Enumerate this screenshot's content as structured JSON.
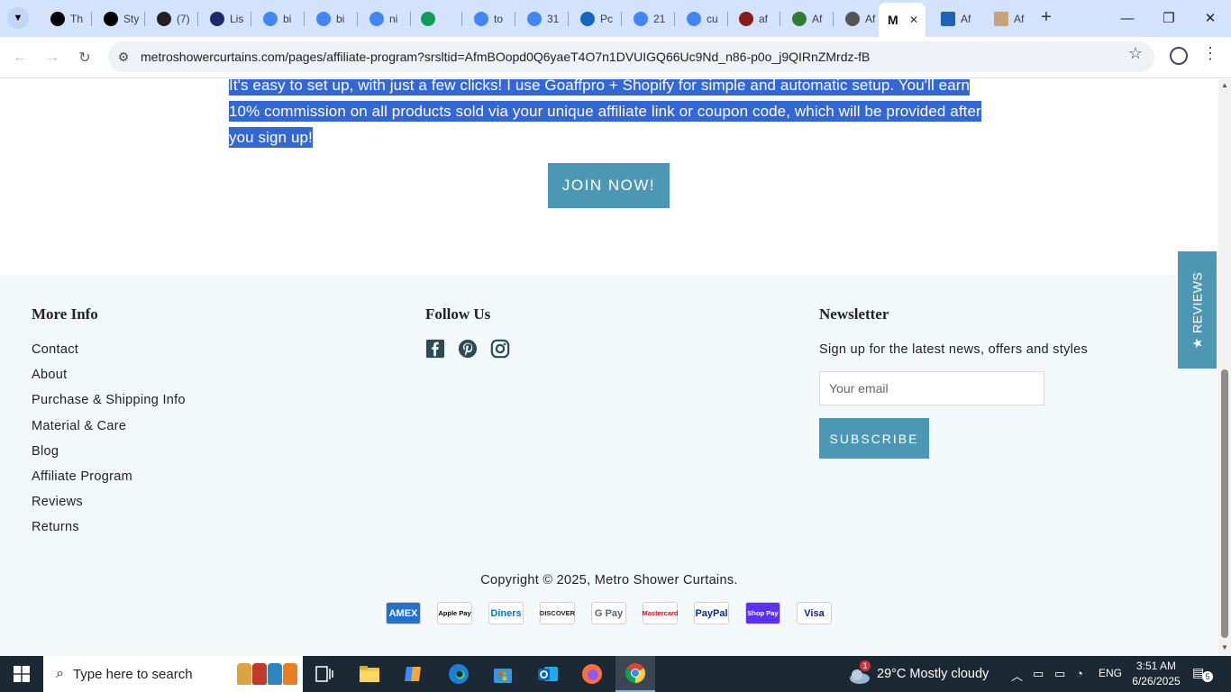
{
  "browser": {
    "tabs": [
      {
        "label": "Th",
        "icon": "threads-icon",
        "color": "#000000"
      },
      {
        "label": "Sty",
        "icon": "threads-icon",
        "color": "#000000"
      },
      {
        "label": "(7)",
        "icon": "quora-icon",
        "color": "#222222"
      },
      {
        "label": "Lis",
        "icon": "ttp-icon",
        "color": "#1a2a6c"
      },
      {
        "label": "bi",
        "icon": "google-icon",
        "color": "#4285f4"
      },
      {
        "label": "bi",
        "icon": "google-icon",
        "color": "#4285f4"
      },
      {
        "label": "ni",
        "icon": "google-icon",
        "color": "#4285f4"
      },
      {
        "label": "",
        "icon": "extension-icon",
        "color": "#0f9d58"
      },
      {
        "label": "to",
        "icon": "google-icon",
        "color": "#4285f4"
      },
      {
        "label": "31",
        "icon": "google-icon",
        "color": "#4285f4"
      },
      {
        "label": "Pc",
        "icon": "xenforo-icon",
        "color": "#1565c0"
      },
      {
        "label": "21",
        "icon": "google-icon",
        "color": "#4285f4"
      },
      {
        "label": "cu",
        "icon": "google-icon",
        "color": "#4285f4"
      },
      {
        "label": "af",
        "icon": "font-icon",
        "color": "#8b1a1a"
      },
      {
        "label": "Af",
        "icon": "sheet-icon",
        "color": "#2e7d32"
      },
      {
        "label": "Af",
        "icon": "curtain-icon",
        "color": "#555555"
      }
    ],
    "active_tab": {
      "label": "M",
      "close": "✕"
    },
    "after_tabs": [
      {
        "label": "Af",
        "icon": "doc-icon",
        "color": "#1e63b5"
      },
      {
        "label": "Af",
        "icon": "curtain-icon",
        "color": "#c8a27a"
      }
    ],
    "new_tab": "+",
    "url": "metroshowercurtains.com/pages/affiliate-program?srsltid=AfmBOopd0Q6yaeT4O7n1DVUIGQ66Uc9Nd_n86-p0o_j9QIRnZMrdz-fB"
  },
  "page": {
    "selected_paragraph": "It's easy to set up, with just a few clicks! I use Goaffpro + Shopify for simple and automatic setup. You'll earn 10% commission on all products sold via your unique affiliate link or coupon code, which will be provided after you sign up!",
    "join_button": "JOIN NOW!",
    "footer": {
      "more_info_title": "More Info",
      "links": [
        "Contact",
        "About",
        "Purchase & Shipping Info",
        "Material & Care",
        "Blog",
        "Affiliate Program",
        "Reviews",
        "Returns"
      ],
      "follow_title": "Follow Us",
      "social": [
        "facebook-icon",
        "pinterest-icon",
        "instagram-icon"
      ],
      "newsletter_title": "Newsletter",
      "newsletter_text": "Sign up for the latest news, offers and styles",
      "email_placeholder": "Your email",
      "subscribe_button": "SUBSCRIBE",
      "copyright": "Copyright © 2025, Metro Shower Curtains.",
      "payments": [
        {
          "name": "AMEX",
          "bg": "#1f72cd",
          "fg": "#ffffff"
        },
        {
          "name": "Apple Pay",
          "bg": "#ffffff",
          "fg": "#000000"
        },
        {
          "name": "Diners",
          "bg": "#ffffff",
          "fg": "#0079be"
        },
        {
          "name": "DISCOVER",
          "bg": "#ffffff",
          "fg": "#222222"
        },
        {
          "name": "G Pay",
          "bg": "#ffffff",
          "fg": "#5f6368"
        },
        {
          "name": "Mastercard",
          "bg": "#ffffff",
          "fg": "#eb001b"
        },
        {
          "name": "PayPal",
          "bg": "#ffffff",
          "fg": "#003087"
        },
        {
          "name": "Shop Pay",
          "bg": "#5a31f4",
          "fg": "#ffffff"
        },
        {
          "name": "Visa",
          "bg": "#ffffff",
          "fg": "#1a1f71"
        }
      ]
    },
    "reviews_tab": "★ REVIEWS"
  },
  "taskbar": {
    "search_placeholder": "Type here to search",
    "weather": "29°C  Mostly cloudy",
    "weather_badge": "1",
    "language": "ENG",
    "time": "3:51 AM",
    "date": "6/26/2025",
    "notifications": "5"
  },
  "colors": {
    "accent": "#4c97b4",
    "selection": "#3367d6",
    "footer_bg": "#f3f8fb"
  }
}
